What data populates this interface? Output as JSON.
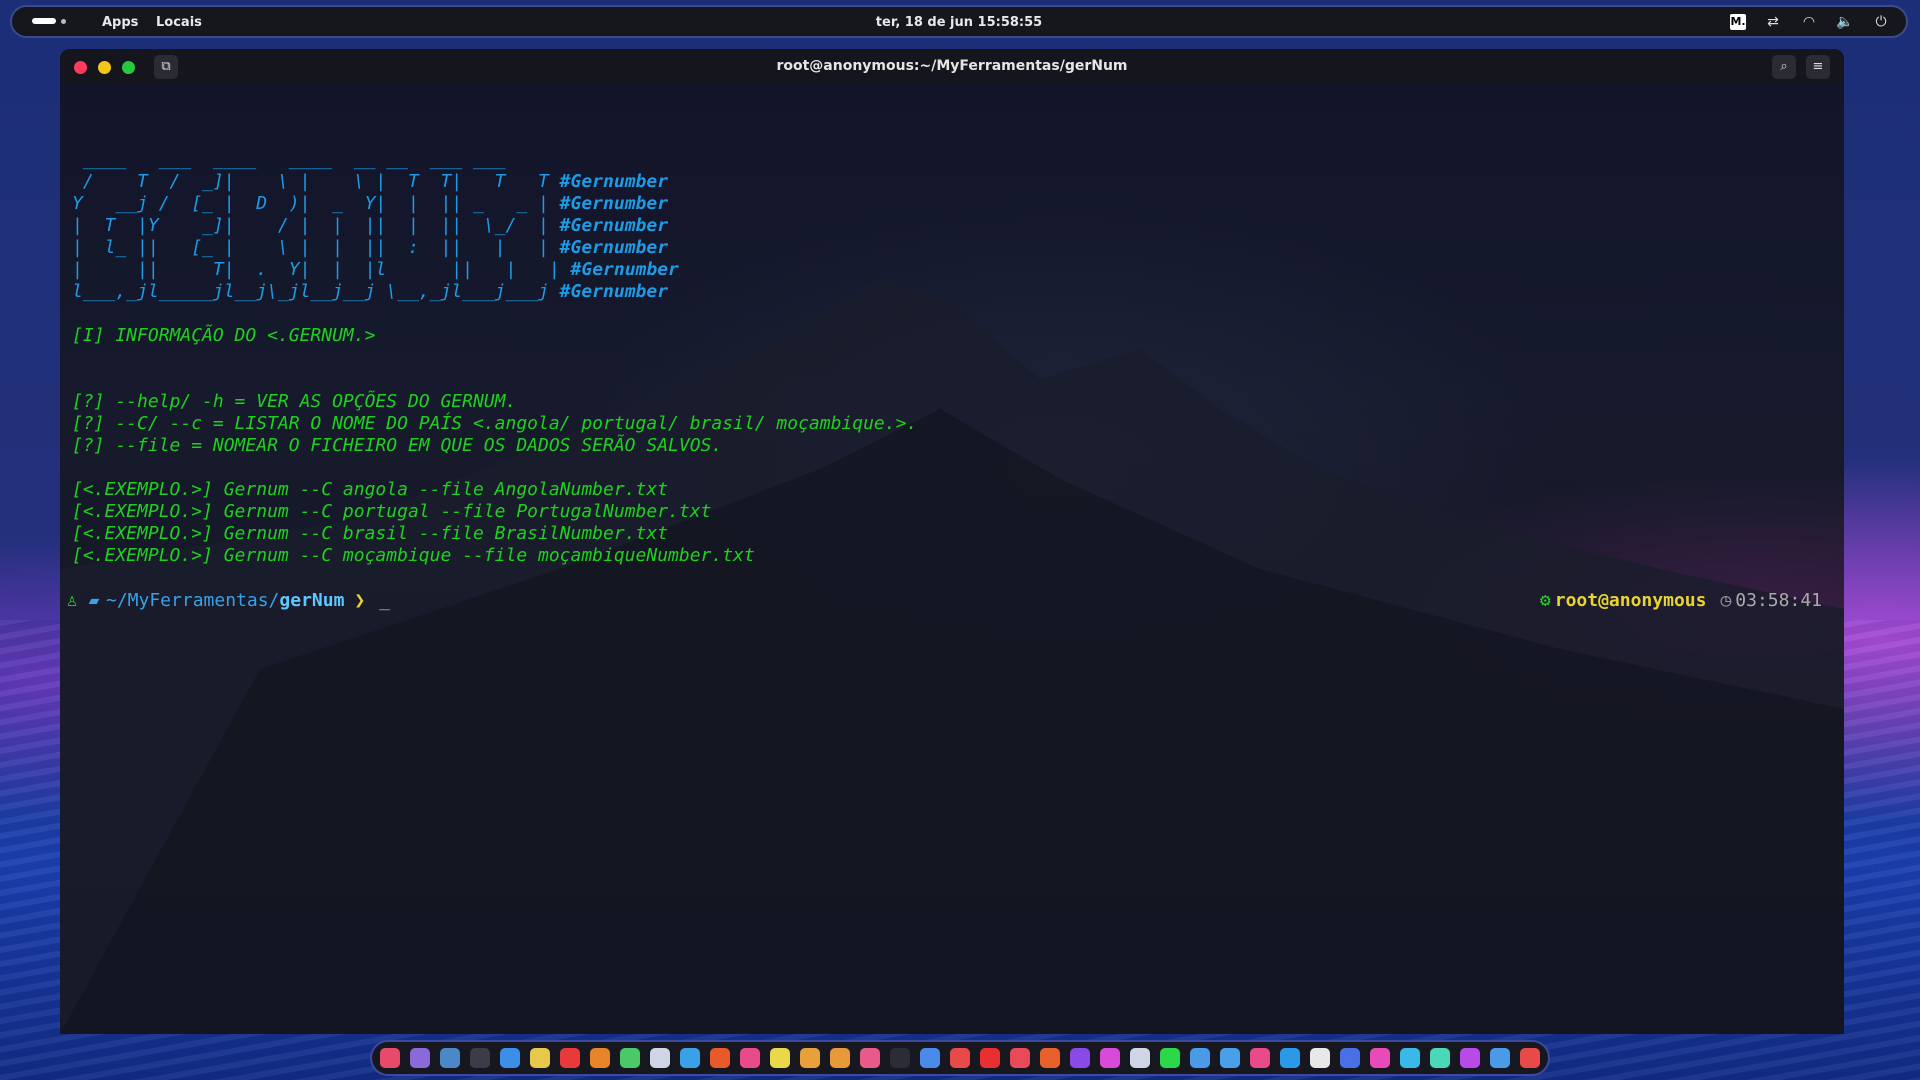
{
  "topbar": {
    "apps_label": "Apps",
    "places_label": "Locais",
    "clock": "ter, 18 de jun  15:58:55",
    "tray": [
      {
        "icon": "m-app-icon",
        "glyph": "M."
      },
      {
        "icon": "sync-icon",
        "glyph": "⇄"
      },
      {
        "icon": "wifi-icon",
        "glyph": "◠"
      },
      {
        "icon": "volume-icon",
        "glyph": "🔈"
      },
      {
        "icon": "power-icon",
        "glyph": "⏻"
      }
    ]
  },
  "window": {
    "title": "root@anonymous:~/MyFerramentas/gerNum",
    "controls": {
      "close_color": "#ff3b5c",
      "min_color": "#f5c518",
      "max_color": "#27c93f"
    }
  },
  "terminal": {
    "banner": [
      " ____   ___  ____   ____  __ __  ___ ___ ",
      " /    T  /  _]|    \\ |    \\ |  T  T|   T   T",
      "Y   __j /  [_ |  D  )|  _  Y|  |  || _   _ |",
      "|  T  |Y    _]|    / |  |  ||  |  ||  \\_/  |",
      "|  l_ ||   [_ |    \\ |  |  ||  :  ||   |   |",
      "|     ||     T|  .  Y|  |  |l      ||   |   |",
      "l___,_jl_____jl__j\\_jl__j__j \\__,_jl___j___j"
    ],
    "banner_tag": "#Gernumber",
    "info_line": "[I] INFORMAÇÃO DO <.GERNUM.>",
    "help_lines": [
      "[?] --help/ -h = VER AS OPÇÕES DO GERNUM.",
      "[?] --C/ --c = LISTAR O NOME DO PAÍS <.angola/ portugal/ brasil/ moçambique.>.",
      "[?] --file = NOMEAR O FICHEIRO EM QUE OS DADOS SERÃO SALVOS."
    ],
    "example_lines": [
      "[<.EXEMPLO.>] Gernum --C angola --file AngolaNumber.txt",
      "[<.EXEMPLO.>] Gernum --C portugal --file PortugalNumber.txt",
      "[<.EXEMPLO.>] Gernum --C brasil --file BrasilNumber.txt",
      "[<.EXEMPLO.>] Gernum --C moçambique --file moçambiqueNumber.txt"
    ],
    "prompt": {
      "path_prefix": "~/MyFerramentas/",
      "path_current": "gerNum",
      "arrow": "❯",
      "cursor": "_",
      "user": "root@anonymous",
      "time": "03:58:41"
    }
  },
  "dock": {
    "colors": [
      "#e84b6a",
      "#8a6ad8",
      "#4a88c8",
      "#3a3c48",
      "#3c8ee8",
      "#e8c84a",
      "#e83a3a",
      "#e8842a",
      "#4ac86a",
      "#cfd6e8",
      "#3aa0e8",
      "#e85a2a",
      "#e84a8a",
      "#e8d84a",
      "#e8a03a",
      "#e89a3a",
      "#e85a8a",
      "#2a2c36",
      "#4a8ae8",
      "#e84a4a",
      "#e83030",
      "#e84a5a",
      "#e8602a",
      "#8a4ae8",
      "#d84ad8",
      "#cfd6e8",
      "#2ad84a",
      "#4a9ae8",
      "#4aa0e8",
      "#e84a8a",
      "#2a9ae8",
      "#e8e8e8",
      "#4a70e8",
      "#e84ab8",
      "#3ab8e8",
      "#4ad8b8",
      "#b84ae8",
      "#4a9ae8",
      "#e84a4a"
    ]
  }
}
